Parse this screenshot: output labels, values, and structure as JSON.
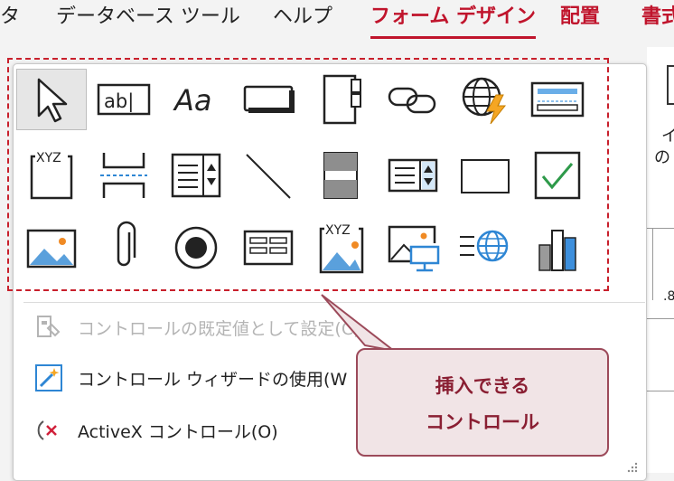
{
  "menu": {
    "items": [
      "タ",
      "データベース ツール",
      "ヘルプ",
      "フォーム デザイン",
      "配置",
      "書式"
    ],
    "active": "フォーム デザイン"
  },
  "controls_gallery": {
    "tools": [
      "select-icon",
      "textbox-icon",
      "label-icon",
      "button-icon",
      "tab-control-icon",
      "hyperlink-icon",
      "web-browser-icon",
      "navigation-control-icon",
      "option-group-icon",
      "page-break-icon",
      "combo-box-icon",
      "line-icon",
      "toggle-button-icon",
      "list-box-icon",
      "rectangle-icon",
      "check-box-icon",
      "unbound-object-frame-icon",
      "attachment-icon",
      "option-button-icon",
      "subform-icon",
      "bound-object-frame-icon",
      "image-icon",
      "insert-web-browser-icon",
      "chart-icon"
    ]
  },
  "commands": {
    "set_default": "コントロールの既定値として設定(C)",
    "wizard": "コントロール ウィザードの使用(W",
    "activex": "ActiveX コントロール(O)"
  },
  "callout": {
    "line1": "挿入できる",
    "line2": "コントロール"
  },
  "ribbon_right": {
    "line1": "イ",
    "line2": "の",
    "tick": ".8"
  },
  "colors": {
    "accent": "#c0142c",
    "callout_border": "#9c4a5a",
    "callout_bg": "#f1e4e6",
    "icon_blue": "#2e86d4"
  }
}
